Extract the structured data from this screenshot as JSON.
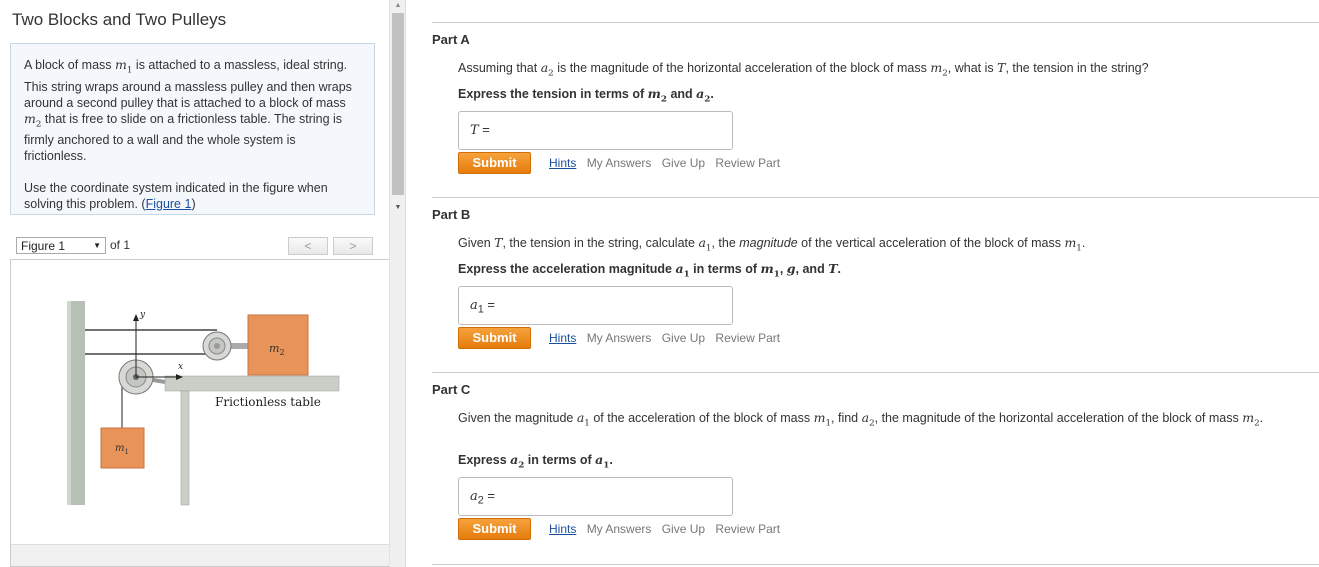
{
  "title": "Two Blocks and Two Pulleys",
  "problem": {
    "p1_pre": "A block of mass ",
    "m1": "m",
    "m1_sub": "1",
    "p1_post": " is attached to a massless, ideal string. This string wraps around a massless pulley and then wraps around a second pulley that is attached to a block of mass ",
    "m2": "m",
    "m2_sub": "2",
    "p1_end": " that is free to slide on a frictionless table. The string is firmly anchored to a wall and the whole system is frictionless.",
    "p2_pre": "Use the coordinate system indicated in the figure when solving this problem. (",
    "figure_link": "Figure 1",
    "p2_end": ")"
  },
  "figure_nav": {
    "selected": "Figure 1",
    "of_text": "of 1",
    "prev": "<",
    "next": ">"
  },
  "figure": {
    "y_label": "y",
    "x_label": "x",
    "m2_label": "m",
    "m2_sub": "2",
    "m1_label": "m",
    "m1_sub": "1",
    "table_label": "Frictionless table",
    "block_color": "#e8935a"
  },
  "parts": [
    {
      "heading": "Part A",
      "q_1": "Assuming that ",
      "q_var1": "a",
      "q_var1_sub": "2",
      "q_2": " is the magnitude of the horizontal acceleration of the block of mass ",
      "q_var2": "m",
      "q_var2_sub": "2",
      "q_3": ", what is ",
      "q_var3": "T",
      "q_4": ", the tension in the string?",
      "express_pre": "Express the tension in terms of ",
      "e_var1": "m",
      "e_var1_sub": "2",
      "e_and": " and ",
      "e_var2": "a",
      "e_var2_sub": "2",
      "e_end": ".",
      "answer_var": "T",
      "answer_sub": "",
      "answer_eq": " ="
    },
    {
      "heading": "Part B",
      "q_1": "Given ",
      "q_var1": "T",
      "q_2": ", the tension in the string, calculate ",
      "q_var2": "a",
      "q_var2_sub": "1",
      "q_3": ", the ",
      "q_italic": "magnitude",
      "q_4": " of the vertical acceleration of the block of mass ",
      "q_var3": "m",
      "q_var3_sub": "1",
      "q_5": ".",
      "express_pre": "Express the acceleration magnitude ",
      "e_var0": "a",
      "e_var0_sub": "1",
      "e_mid": " in terms of ",
      "e_var1": "m",
      "e_var1_sub": "1",
      "e_comma": ", ",
      "e_var2": "g",
      "e_and": ", and ",
      "e_var3": "T",
      "e_end": ".",
      "answer_var": "a",
      "answer_sub": "1",
      "answer_eq": " ="
    },
    {
      "heading": "Part C",
      "q_1": "Given the magnitude ",
      "q_var1": "a",
      "q_var1_sub": "1",
      "q_2": " of the acceleration of the block of mass ",
      "q_var2": "m",
      "q_var2_sub": "1",
      "q_3": ", find ",
      "q_var3": "a",
      "q_var3_sub": "2",
      "q_4": ", the magnitude of the horizontal acceleration of the block of mass ",
      "q_var4": "m",
      "q_var4_sub": "2",
      "q_5": ".",
      "express_pre": "Express ",
      "e_var1": "a",
      "e_var1_sub": "2",
      "e_mid": " in terms of ",
      "e_var2": "a",
      "e_var2_sub": "1",
      "e_end": ".",
      "answer_var": "a",
      "answer_sub": "2",
      "answer_eq": " ="
    }
  ],
  "actions": {
    "submit": "Submit",
    "hints": "Hints",
    "my_answers": "My Answers",
    "give_up": "Give Up",
    "review_part": "Review Part"
  },
  "colors": {
    "submit_orange": "#ef8c1e",
    "link_blue": "#1a4f9c",
    "problem_bg": "#f4f8fc"
  }
}
